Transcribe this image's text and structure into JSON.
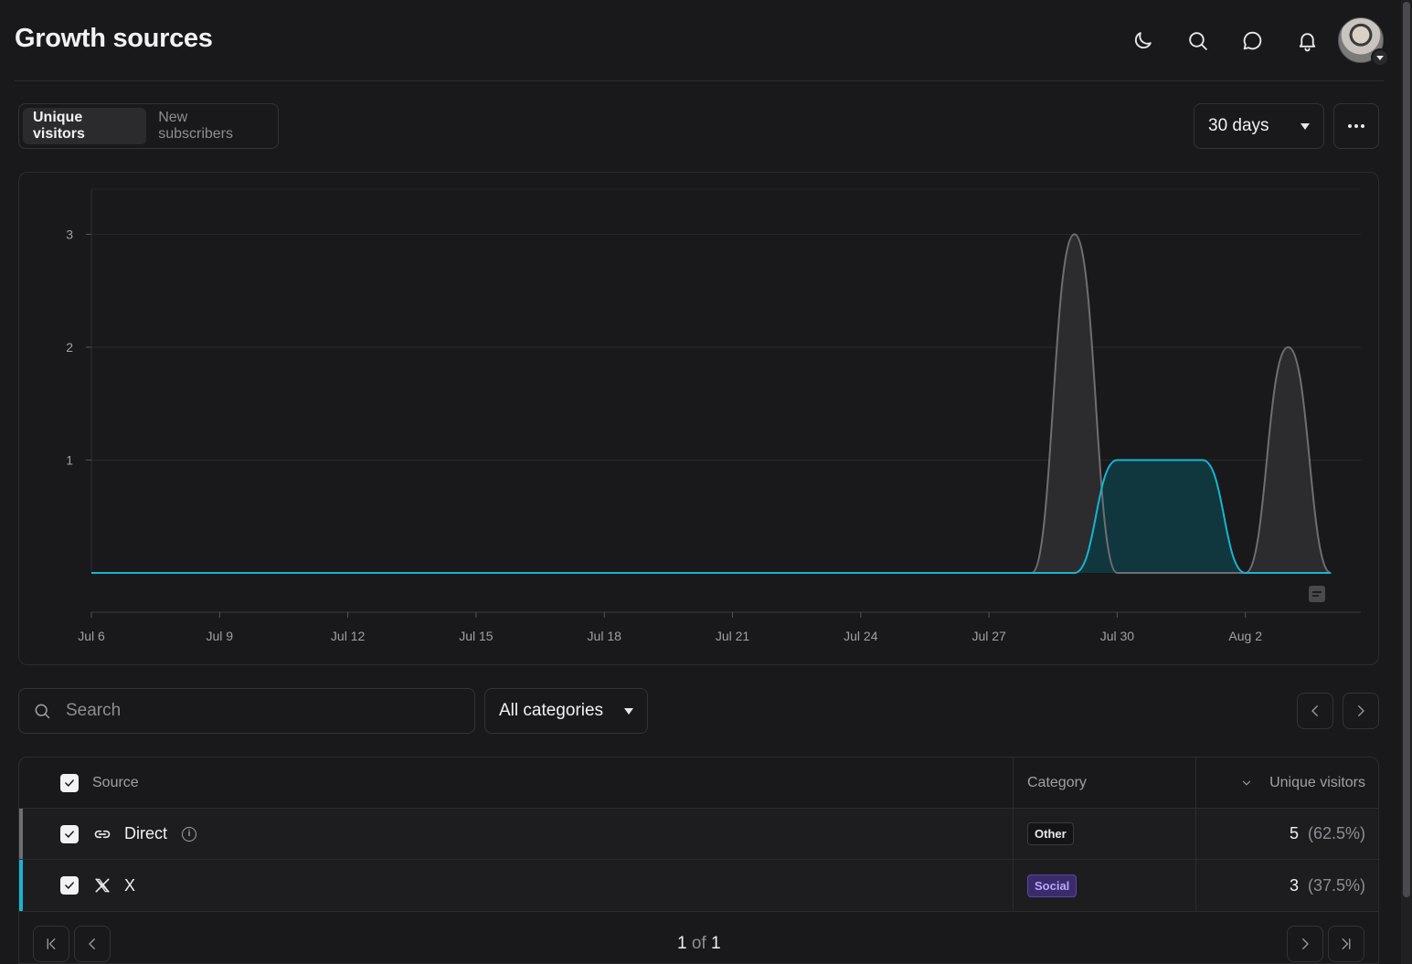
{
  "header": {
    "title": "Growth sources",
    "icons": [
      "moon-icon",
      "search-icon",
      "chat-icon",
      "bell-icon"
    ]
  },
  "tabs": [
    {
      "label": "Unique visitors",
      "active": true
    },
    {
      "label": "New subscribers",
      "active": false
    }
  ],
  "range": {
    "label": "30 days"
  },
  "chart_data": {
    "type": "area",
    "title": "",
    "xlabel": "",
    "ylabel": "",
    "x_ticks": [
      "Jul 6",
      "Jul 9",
      "Jul 12",
      "Jul 15",
      "Jul 18",
      "Jul 21",
      "Jul 24",
      "Jul 27",
      "Jul 30",
      "Aug 2"
    ],
    "y_ticks": [
      1,
      2,
      3
    ],
    "ylim": [
      0,
      3.4
    ],
    "x": [
      "Jul 6",
      "Jul 7",
      "Jul 8",
      "Jul 9",
      "Jul 10",
      "Jul 11",
      "Jul 12",
      "Jul 13",
      "Jul 14",
      "Jul 15",
      "Jul 16",
      "Jul 17",
      "Jul 18",
      "Jul 19",
      "Jul 20",
      "Jul 21",
      "Jul 22",
      "Jul 23",
      "Jul 24",
      "Jul 25",
      "Jul 26",
      "Jul 27",
      "Jul 28",
      "Jul 29",
      "Jul 30",
      "Jul 31",
      "Aug 1",
      "Aug 2",
      "Aug 3",
      "Aug 4"
    ],
    "series": [
      {
        "name": "Direct",
        "color": "#6e6e73",
        "values": [
          0,
          0,
          0,
          0,
          0,
          0,
          0,
          0,
          0,
          0,
          0,
          0,
          0,
          0,
          0,
          0,
          0,
          0,
          0,
          0,
          0,
          0,
          0,
          3,
          0,
          0,
          0,
          0,
          2,
          0
        ]
      },
      {
        "name": "X",
        "color": "#18b4d0",
        "values": [
          0,
          0,
          0,
          0,
          0,
          0,
          0,
          0,
          0,
          0,
          0,
          0,
          0,
          0,
          0,
          0,
          0,
          0,
          0,
          0,
          0,
          0,
          0,
          0,
          1,
          1,
          1,
          0,
          0,
          0
        ]
      }
    ],
    "grid": true
  },
  "filters": {
    "search_placeholder": "Search",
    "category_label": "All categories"
  },
  "table": {
    "columns": {
      "source": "Source",
      "category": "Category",
      "visitors": "Unique visitors"
    },
    "rows": [
      {
        "source": "Direct",
        "category": "Other",
        "value": "5",
        "pct": "(62.5%)",
        "color": "#6e6e73"
      },
      {
        "source": "X",
        "category": "Social",
        "value": "3",
        "pct": "(37.5%)",
        "color": "#18b4d0"
      }
    ]
  },
  "pagination": {
    "current": "1",
    "of": "of",
    "total": "1"
  }
}
